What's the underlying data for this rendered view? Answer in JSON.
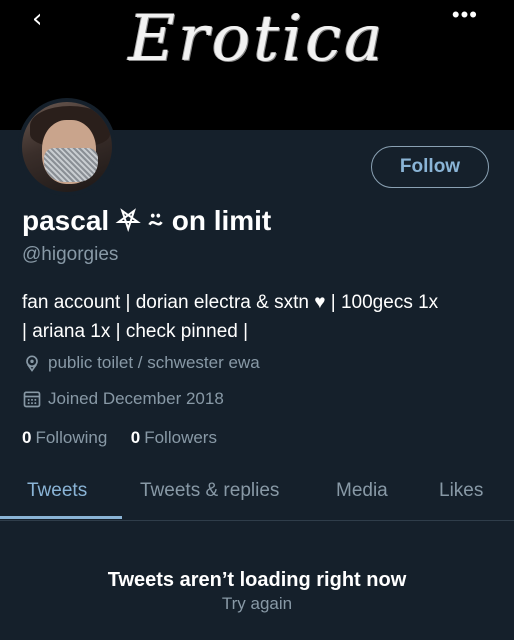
{
  "header": {
    "banner_title": "Erotica",
    "back_icon": "chevron-left-icon",
    "more_icon": "more-dots-icon",
    "back_glyph": "‹",
    "more_glyph": "•••"
  },
  "profile": {
    "follow_label": "Follow",
    "display_name": "pascal ⛧ ⍨ on limit",
    "handle": "@higorgies",
    "bio_line1": "fan account | dorian electra & sxtn ♥ | 100gecs 1x",
    "bio_line2": "| ariana 1x | check pinned |",
    "location": "public toilet / schwester ewa",
    "joined": "Joined December 2018",
    "following_count": "0",
    "following_label": "Following",
    "followers_count": "0",
    "followers_label": "Followers"
  },
  "tabs": [
    {
      "label": "Tweets",
      "active": true
    },
    {
      "label": "Tweets & replies",
      "active": false
    },
    {
      "label": "Media",
      "active": false
    },
    {
      "label": "Likes",
      "active": false
    }
  ],
  "timeline": {
    "error_title": "Tweets aren’t loading right now",
    "retry_label": "Try again"
  },
  "colors": {
    "background": "#15202b",
    "accent": "#8ab4d6",
    "secondary_text": "#8899a6"
  }
}
